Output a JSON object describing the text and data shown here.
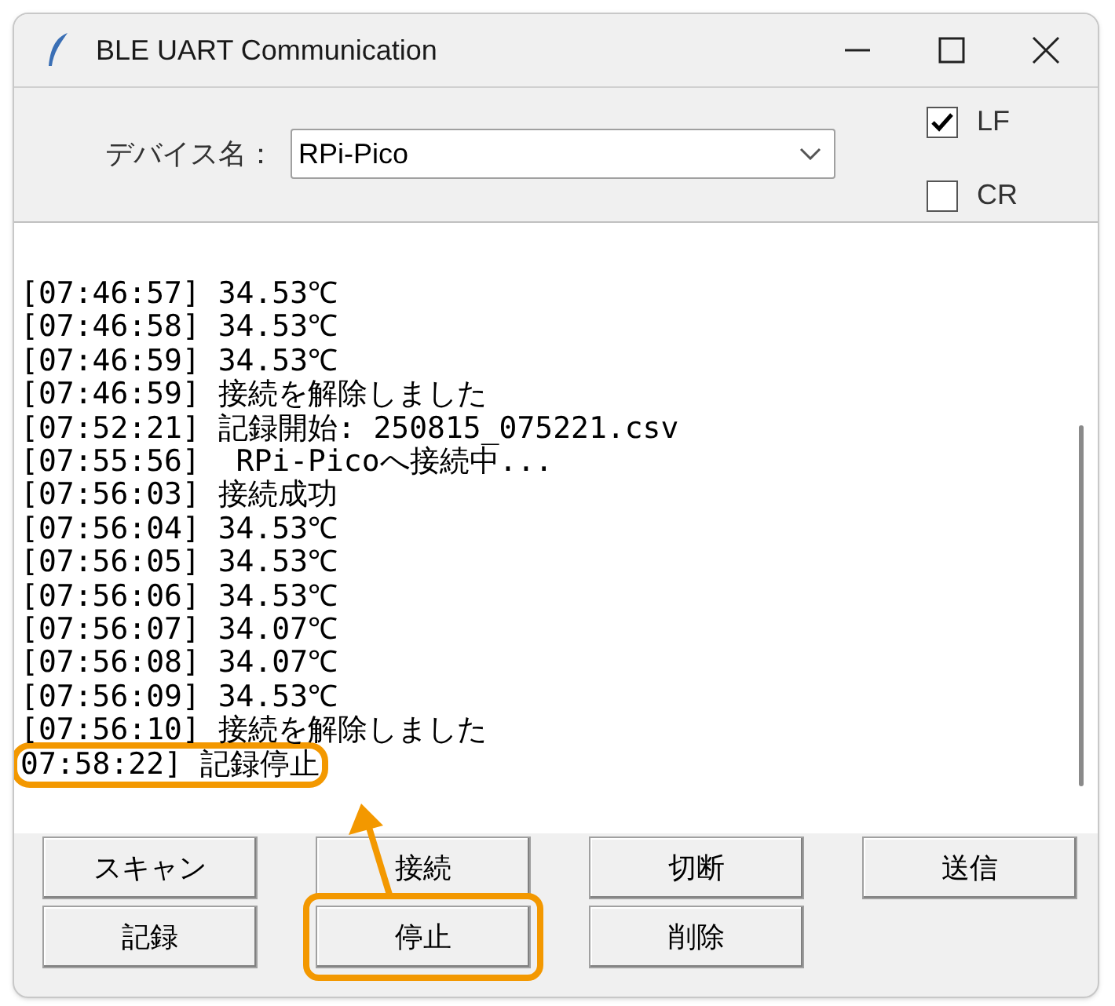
{
  "window": {
    "title": "BLE UART Communication"
  },
  "device": {
    "label": "デバイス名：",
    "value": "RPi-Pico"
  },
  "options": [
    {
      "label": "LF",
      "checked": true
    },
    {
      "label": "CR",
      "checked": false
    }
  ],
  "log": [
    {
      "time": "[07:46:57]",
      "message": "34.53℃",
      "highlighted": false
    },
    {
      "time": "[07:46:58]",
      "message": "34.53℃",
      "highlighted": false
    },
    {
      "time": "[07:46:59]",
      "message": "34.53℃",
      "highlighted": false
    },
    {
      "time": "[07:46:59]",
      "message": "接続を解除しました",
      "highlighted": false
    },
    {
      "time": "[07:52:21]",
      "message": "記録開始: 250815_075221.csv",
      "highlighted": false
    },
    {
      "time": "[07:55:56]",
      "message": " RPi-Picoへ接続中...",
      "highlighted": false
    },
    {
      "time": "[07:56:03]",
      "message": "接続成功",
      "highlighted": false
    },
    {
      "time": "[07:56:04]",
      "message": "34.53℃",
      "highlighted": false
    },
    {
      "time": "[07:56:05]",
      "message": "34.53℃",
      "highlighted": false
    },
    {
      "time": "[07:56:06]",
      "message": "34.53℃",
      "highlighted": false
    },
    {
      "time": "[07:56:07]",
      "message": "34.07℃",
      "highlighted": false
    },
    {
      "time": "[07:56:08]",
      "message": "34.07℃",
      "highlighted": false
    },
    {
      "time": "[07:56:09]",
      "message": "34.53℃",
      "highlighted": false
    },
    {
      "time": "[07:56:10]",
      "message": "接続を解除しました",
      "highlighted": false
    },
    {
      "time": "07:58:22]",
      "message": "記録停止",
      "highlighted": true
    }
  ],
  "buttons": [
    {
      "label": "スキャン",
      "highlighted": false
    },
    {
      "label": "接続",
      "highlighted": false
    },
    {
      "label": "切断",
      "highlighted": false
    },
    {
      "label": "送信",
      "highlighted": false
    },
    {
      "label": "記録",
      "highlighted": false
    },
    {
      "label": "停止",
      "highlighted": true
    },
    {
      "label": "削除",
      "highlighted": false
    }
  ]
}
